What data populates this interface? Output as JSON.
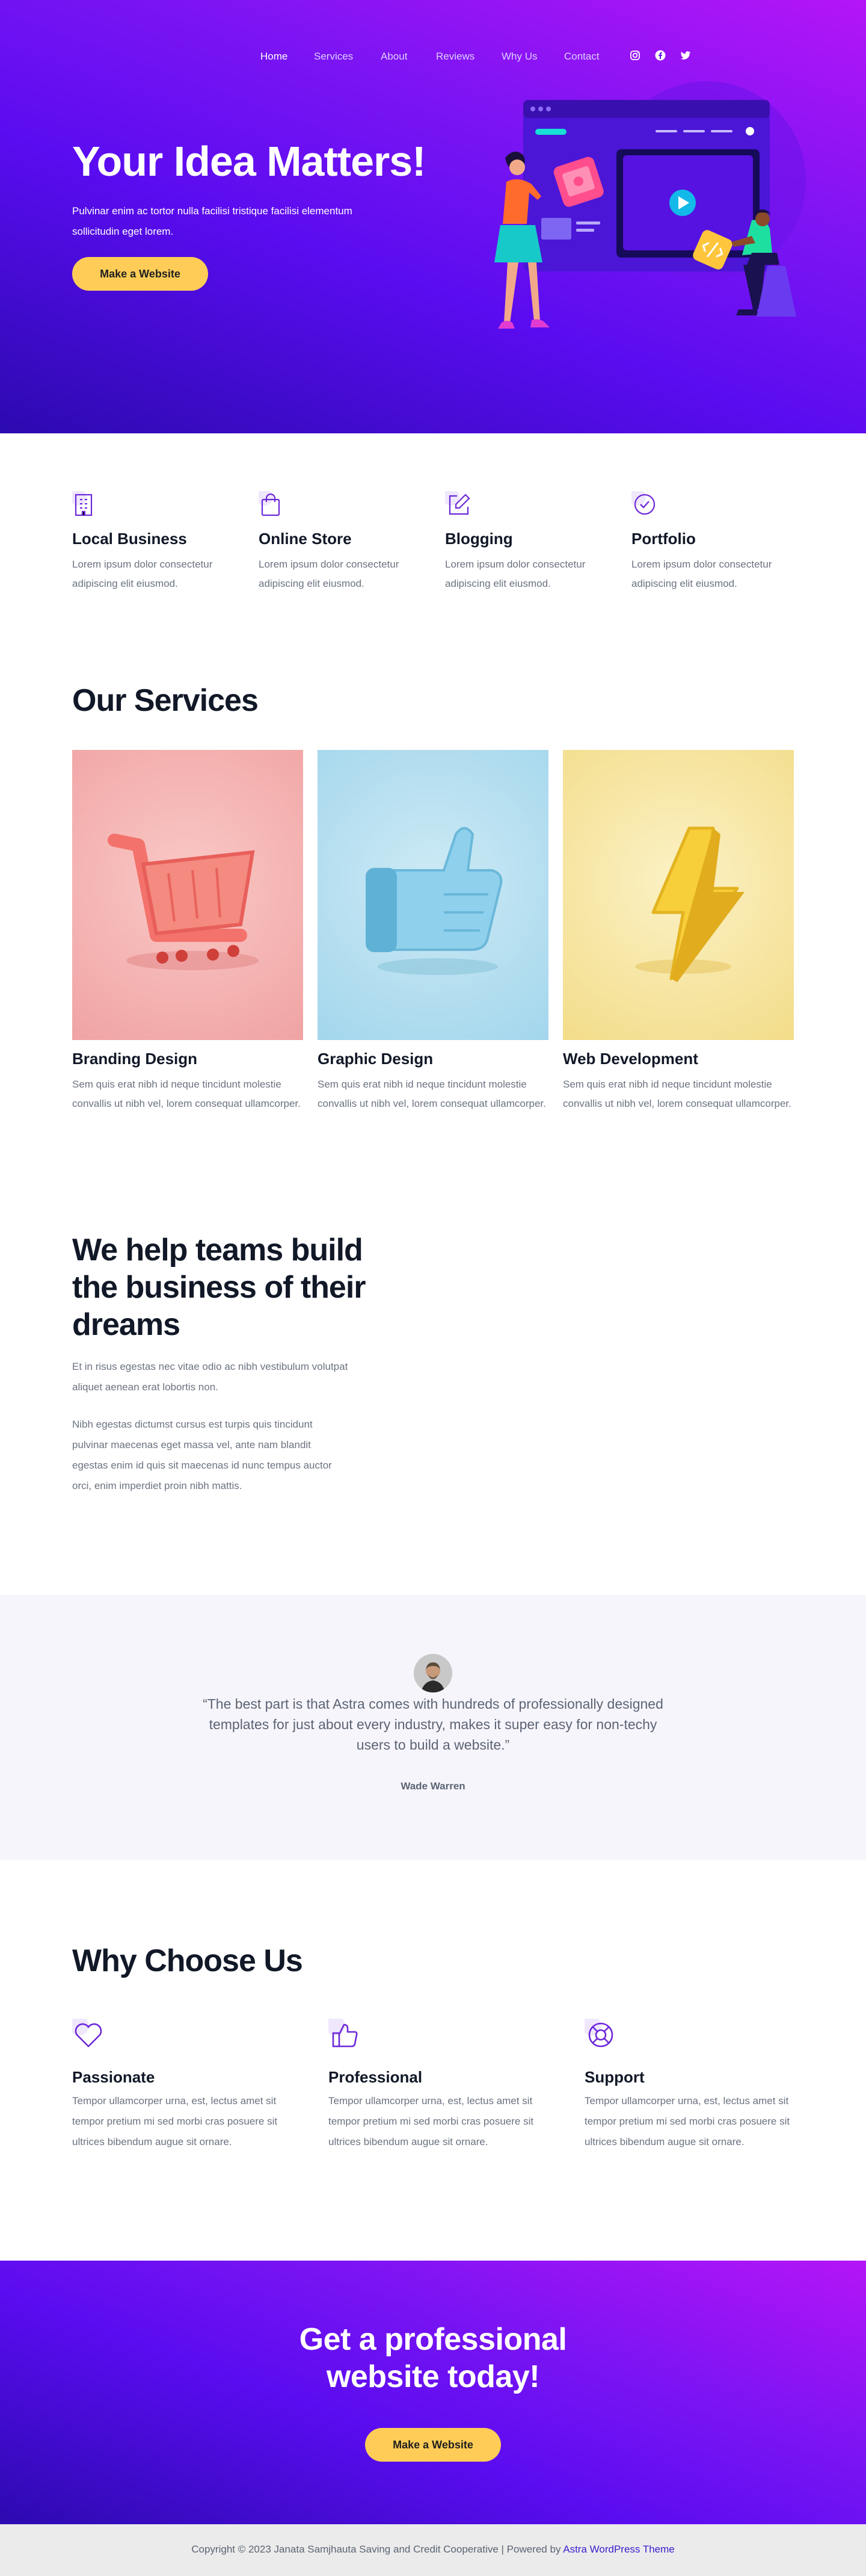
{
  "nav": {
    "items": [
      "Home",
      "Services",
      "About",
      "Reviews",
      "Why Us",
      "Contact"
    ],
    "social": [
      "instagram-icon",
      "facebook-icon",
      "twitter-icon"
    ]
  },
  "hero": {
    "title": "Your Idea Matters!",
    "subtitle": "Pulvinar enim ac tortor nulla facilisi tristique facilisi elementum sollicitudin eget lorem.",
    "button": "Make a Website"
  },
  "features": [
    {
      "icon": "building-icon",
      "title": "Local Business",
      "text": "Lorem ipsum dolor consectetur adipiscing elit eiusmod."
    },
    {
      "icon": "shopping-bag-icon",
      "title": "Online Store",
      "text": "Lorem ipsum dolor consectetur adipiscing elit eiusmod."
    },
    {
      "icon": "edit-icon",
      "title": "Blogging",
      "text": "Lorem ipsum dolor consectetur adipiscing elit eiusmod."
    },
    {
      "icon": "badge-check-icon",
      "title": "Portfolio",
      "text": "Lorem ipsum dolor consectetur adipiscing elit eiusmod."
    }
  ],
  "services": {
    "title": "Our Services",
    "items": [
      {
        "title": "Branding Design",
        "text": "Sem quis erat nibh id neque tincidunt molestie convallis ut nibh vel, lorem consequat ullamcorper."
      },
      {
        "title": "Graphic Design",
        "text": "Sem quis erat nibh id neque tincidunt molestie convallis ut nibh vel, lorem consequat ullamcorper."
      },
      {
        "title": "Web Development",
        "text": "Sem quis erat nibh id neque tincidunt molestie convallis ut nibh vel, lorem consequat ullamcorper."
      }
    ]
  },
  "help": {
    "title": "We help teams build the business of their dreams",
    "p1": "Et in risus egestas nec vitae odio ac nibh vestibulum volutpat aliquet aenean erat lobortis non.",
    "p2": "Nibh egestas dictumst cursus est turpis quis tincidunt pulvinar maecenas eget massa vel, ante nam blandit egestas enim id quis sit maecenas id nunc tempus auctor orci, enim imperdiet proin nibh mattis."
  },
  "testimonial": {
    "quote": "“The best part is that Astra comes with hundreds of professionally designed templates for just about every industry, makes it super easy for non-techy users to build a website.”",
    "author": "Wade Warren"
  },
  "why": {
    "title": "Why Choose Us",
    "items": [
      {
        "icon": "heart-icon",
        "title": "Passionate",
        "text": "Tempor ullamcorper urna, est, lectus amet sit tempor pretium mi sed morbi cras posuere sit ultrices bibendum augue sit ornare."
      },
      {
        "icon": "thumbs-up-icon",
        "title": "Professional",
        "text": "Tempor ullamcorper urna, est, lectus amet sit tempor pretium mi sed morbi cras posuere sit ultrices bibendum augue sit ornare."
      },
      {
        "icon": "lifebuoy-icon",
        "title": "Support",
        "text": "Tempor ullamcorper urna, est, lectus amet sit tempor pretium mi sed morbi cras posuere sit ultrices bibendum augue sit ornare."
      }
    ]
  },
  "cta": {
    "title": "Get a professional website today!",
    "button": "Make a Website"
  },
  "footer": {
    "copyright": "Copyright © 2023 Janata Samjhauta Saving and Credit Cooperative | Powered by",
    "link": "Astra WordPress Theme"
  },
  "colors": {
    "accent": "#7a14f3",
    "button": "#ffcd57",
    "icon_purple": "#6d28d9"
  }
}
